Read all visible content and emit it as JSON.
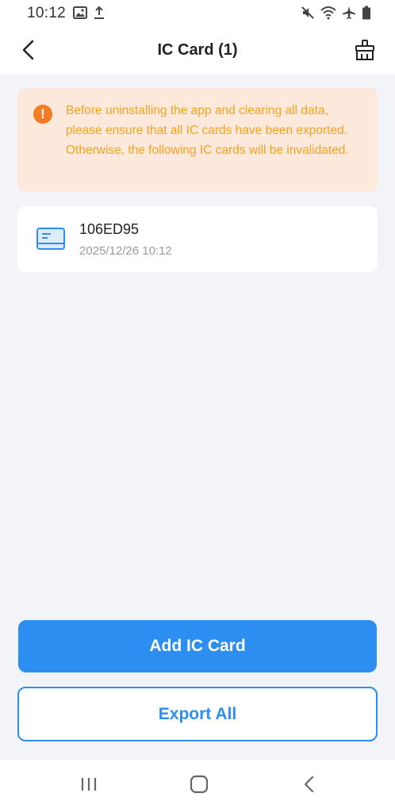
{
  "status_bar": {
    "time": "10:12",
    "left_icons": [
      "image-icon",
      "upload-icon"
    ],
    "right_icons": [
      "mute-icon",
      "wifi-icon",
      "airplane-icon",
      "battery-icon"
    ]
  },
  "header": {
    "title": "IC Card (1)",
    "back_icon": "chevron-left-icon",
    "clear_icon": "broom-icon"
  },
  "warning": {
    "icon": "exclamation-icon",
    "text": "Before uninstalling the app and clearing all data, please ensure that all IC cards have been exported. Otherwise, the following IC cards will be invalidated.",
    "background_color": "#fde8dc",
    "text_color": "#f2a41e",
    "icon_color": "#f27c24"
  },
  "cards": [
    {
      "number": "106ED95",
      "date": "2025/12/26 10:12",
      "icon": "card-icon"
    }
  ],
  "actions": {
    "add_label": "Add IC Card",
    "export_label": "Export All",
    "accent_color": "#2c8ef0"
  },
  "nav": {
    "recents_icon": "recents-icon",
    "home_icon": "home-icon",
    "back_icon": "nav-back-icon"
  }
}
